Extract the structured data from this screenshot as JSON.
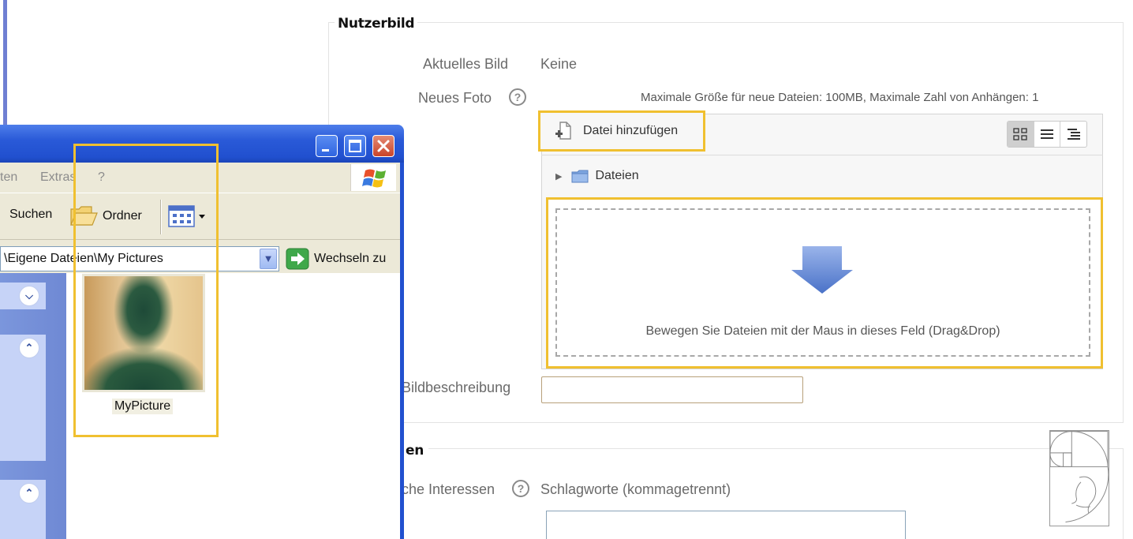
{
  "form": {
    "section_title": "Nutzerbild",
    "current_image_label": "Aktuelles Bild",
    "current_image_value": "Keine",
    "new_photo_label": "Neues Foto",
    "help_glyph": "?",
    "max_size_text": "Maximale Größe für neue Dateien: 100MB, Maximale Zahl von Anhängen: 1",
    "add_file_label": "Datei hinzufügen",
    "folder_label": "Dateien",
    "dropzone_text": "Bewegen Sie Dateien mit der Maus in dieses Feld (Drag&Drop)",
    "image_description_label": "Bildbeschreibung",
    "image_description_value": "",
    "second_section_title": "en",
    "interests_label": "che Interessen",
    "interests_hint": "Schlagworte (kommagetrennt)",
    "icons": {
      "view_icons": "grid-view-icon",
      "view_list": "list-view-icon",
      "view_tree": "tree-view-icon",
      "folder": "folder-icon",
      "drop_arrow": "down-arrow-icon"
    }
  },
  "explorer": {
    "menu": [
      "ten",
      "Extras",
      "?"
    ],
    "toolbar": {
      "search_label": "Suchen",
      "folders_label": "Ordner"
    },
    "address_value": "\\Eigene Dateien\\My Pictures",
    "go_label": "Wechseln zu",
    "file_name": "MyPicture",
    "colors": {
      "titlebar": "#2150cf",
      "highlight": "#f0c030"
    }
  }
}
